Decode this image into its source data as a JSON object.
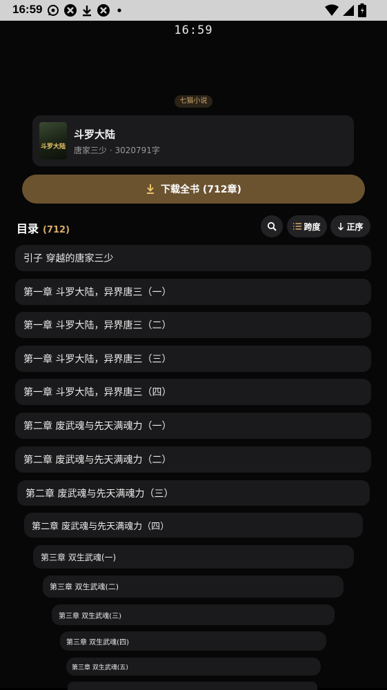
{
  "status_bar": {
    "time": "16:59"
  },
  "header": {
    "clock": "16:59"
  },
  "source": {
    "label": "七猫小说"
  },
  "book": {
    "title": "斗罗大陆",
    "meta": "唐家三少 · 3020791字",
    "cover_text": "斗罗大陆"
  },
  "download": {
    "label": "下载全书 (712章)"
  },
  "toc": {
    "title": "目录",
    "count": "(712)",
    "actions": {
      "search_icon": "search-icon",
      "span_label": "跨度",
      "order_label": "正序"
    },
    "chapters": [
      "引子 穿越的唐家三少",
      "第一章 斗罗大陆，异界唐三（一）",
      "第一章 斗罗大陆，异界唐三（二）",
      "第一章 斗罗大陆，异界唐三（三）",
      "第一章 斗罗大陆，异界唐三（四）",
      "第二章 废武魂与先天满魂力（一）",
      "第二章 废武魂与先天满魂力（二）",
      "第二章 废武魂与先天满魂力（三）",
      "第二章 废武魂与先天满魂力（四）",
      "第三章 双生武魂(一)",
      "第三章 双生武魂(二)",
      "第三章 双生武魂(三)",
      "第三章 双生武魂(四)",
      "第三章 双生武魂(五)"
    ]
  },
  "colors": {
    "accent": "#d7ad6a",
    "download_bg": "#6b5330",
    "card_bg": "#1b1b1d"
  }
}
